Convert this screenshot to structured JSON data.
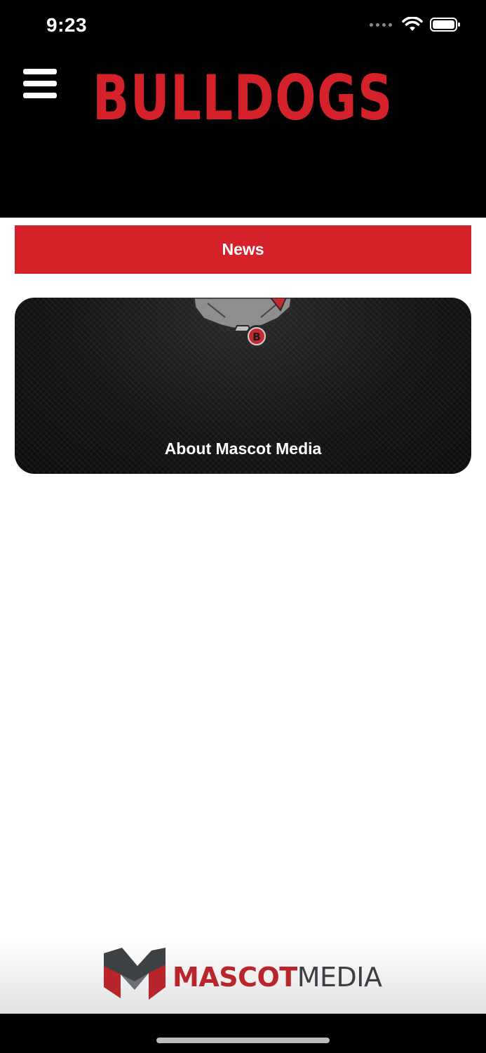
{
  "status_bar": {
    "time": "9:23"
  },
  "header": {
    "title": "BULLDOGS",
    "menu_icon": "hamburger-menu-icon"
  },
  "nav": {
    "news_label": "News"
  },
  "card": {
    "title": "About Mascot Media",
    "image": "bulldog-mascot-icon"
  },
  "footer": {
    "logo_word_1": "MASCOT",
    "logo_word_2": "MEDIA"
  },
  "colors": {
    "brand_red": "#d5222a",
    "background": "#000000"
  }
}
